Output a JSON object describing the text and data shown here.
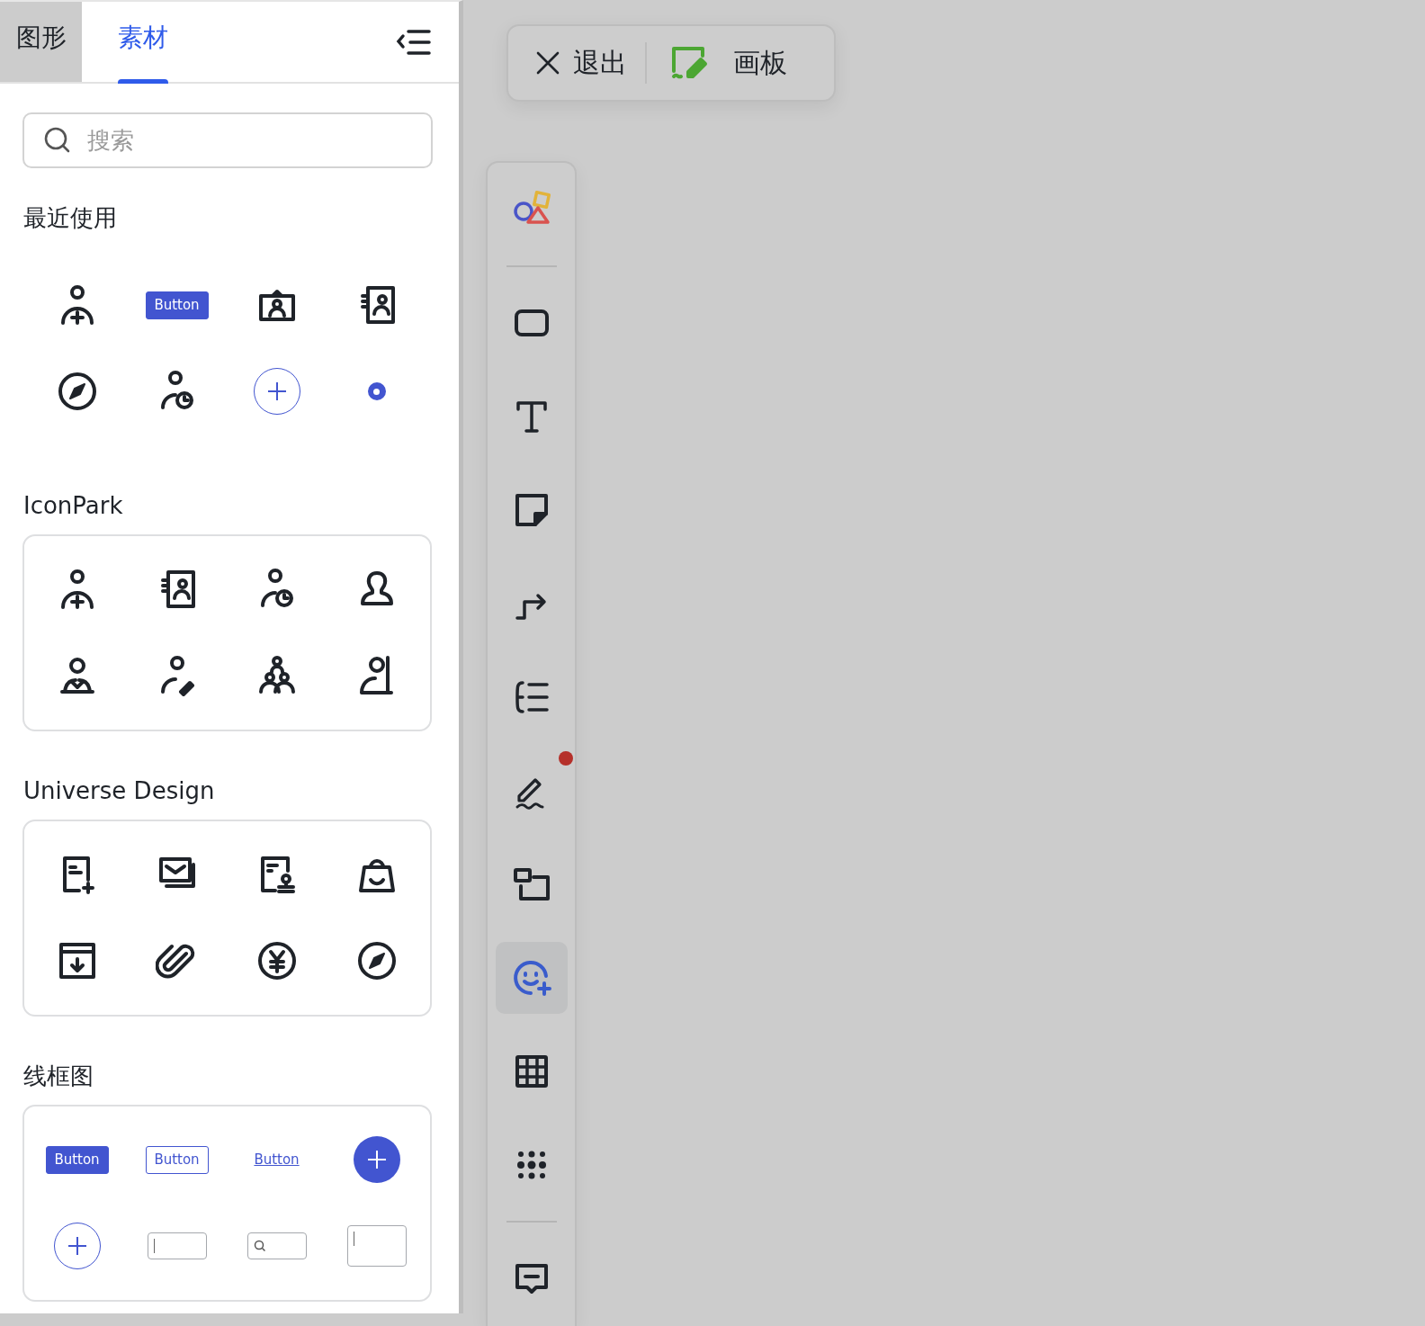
{
  "panel": {
    "tabs": [
      {
        "label": "图形",
        "selected": false
      },
      {
        "label": "素材",
        "selected": true
      }
    ],
    "search": {
      "placeholder": "搜索"
    },
    "sections": [
      {
        "title": "最近使用",
        "kind": "plain",
        "items": [
          {
            "kind": "icon"
          },
          {
            "kind": "filled-button",
            "label": "Button"
          },
          {
            "kind": "icon"
          },
          {
            "kind": "icon"
          },
          {
            "kind": "icon"
          },
          {
            "kind": "icon"
          },
          {
            "kind": "add-circle"
          },
          {
            "kind": "radio"
          }
        ]
      },
      {
        "title": "IconPark",
        "kind": "card",
        "items": [
          {
            "kind": "icon"
          },
          {
            "kind": "icon"
          },
          {
            "kind": "icon"
          },
          {
            "kind": "icon"
          },
          {
            "kind": "icon"
          },
          {
            "kind": "icon"
          },
          {
            "kind": "icon"
          },
          {
            "kind": "icon"
          }
        ]
      },
      {
        "title": "Universe Design",
        "kind": "card",
        "items": [
          {
            "kind": "icon"
          },
          {
            "kind": "icon"
          },
          {
            "kind": "icon"
          },
          {
            "kind": "icon"
          },
          {
            "kind": "icon"
          },
          {
            "kind": "icon"
          },
          {
            "kind": "icon"
          },
          {
            "kind": "icon"
          }
        ]
      },
      {
        "title": "线框图",
        "kind": "card",
        "items": [
          {
            "kind": "filled-button",
            "label": "Button"
          },
          {
            "kind": "outline-button",
            "label": "Button"
          },
          {
            "kind": "link-button",
            "label": "Button"
          },
          {
            "kind": "fab"
          },
          {
            "kind": "add-circle"
          },
          {
            "kind": "input"
          },
          {
            "kind": "search-input"
          },
          {
            "kind": "textarea"
          }
        ]
      }
    ]
  },
  "top_bar": {
    "exit_label": "退出",
    "board_label": "画板"
  },
  "tools": [
    {
      "kind": "tool",
      "selected": false,
      "badge": false
    },
    {
      "kind": "divider"
    },
    {
      "kind": "tool",
      "selected": false,
      "badge": false
    },
    {
      "kind": "tool",
      "selected": false,
      "badge": false
    },
    {
      "kind": "tool",
      "selected": false,
      "badge": false
    },
    {
      "kind": "tool",
      "selected": false,
      "badge": false
    },
    {
      "kind": "tool",
      "selected": false,
      "badge": false
    },
    {
      "kind": "tool",
      "selected": false,
      "badge": true
    },
    {
      "kind": "tool",
      "selected": false,
      "badge": false
    },
    {
      "kind": "tool",
      "selected": true,
      "badge": false
    },
    {
      "kind": "tool",
      "selected": false,
      "badge": false
    },
    {
      "kind": "tool",
      "selected": false,
      "badge": false
    },
    {
      "kind": "divider"
    },
    {
      "kind": "tool",
      "selected": false,
      "badge": false
    }
  ]
}
